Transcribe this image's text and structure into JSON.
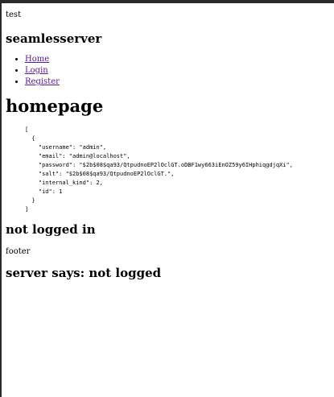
{
  "header": {
    "text": "test"
  },
  "site": {
    "title": "seamlesserver"
  },
  "nav": {
    "items": [
      {
        "label": "Home"
      },
      {
        "label": "Login"
      },
      {
        "label": "Register"
      }
    ]
  },
  "main": {
    "heading": "homepage",
    "json_lines": [
      "[",
      "  {",
      "    \"username\": \"admin\",",
      "    \"email\": \"admin@localhost\",",
      "    \"password\": \"$2b$08$qa93/QtpudnoEP2lOclGT.oDBF1wy663iEnOZ59y6IHphiqgdjqXi\",",
      "    \"salt\": \"$2b$08$qa93/QtpudnoEP2lOclGT.\",",
      "    \"internal_kind\": 2,",
      "    \"id\": 1",
      "  }",
      "]"
    ],
    "status": "not logged in"
  },
  "footer": {
    "text": "footer",
    "server_message": "server says: not logged"
  }
}
